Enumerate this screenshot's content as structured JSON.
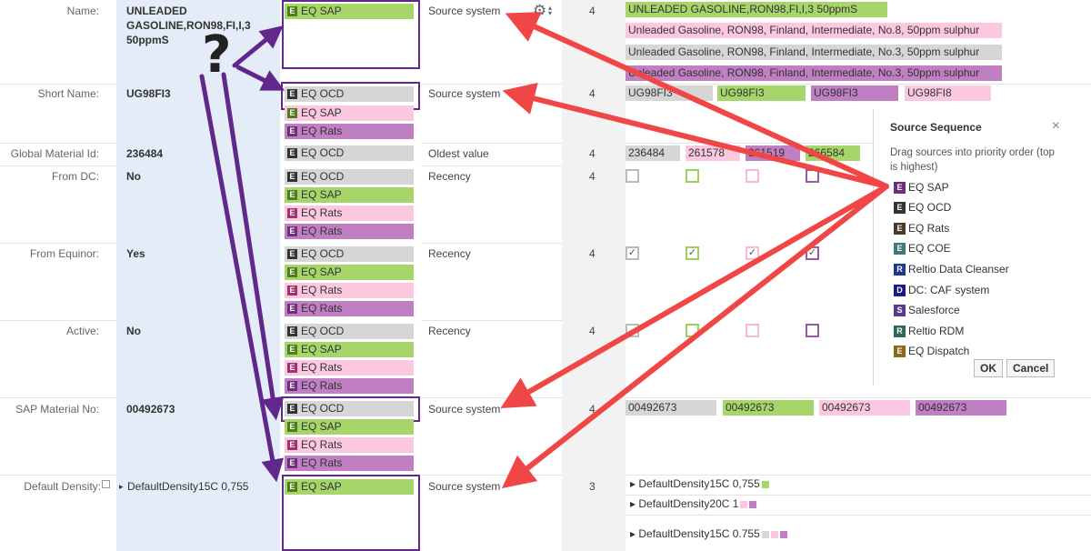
{
  "rows": [
    {
      "label": "Name:",
      "value": "UNLEADED\nGASOLINE,RON98,FI,I,3\n50ppmS",
      "rule": "Source system",
      "count": "4"
    },
    {
      "label": "Short Name:",
      "value": "UG98FI3",
      "rule": "Source system",
      "count": "4"
    },
    {
      "label": "Global Material Id:",
      "value": "236484",
      "rule": "Oldest value",
      "count": "4"
    },
    {
      "label": "From DC:",
      "value": "No",
      "rule": "Recency",
      "count": "4"
    },
    {
      "label": "From Equinor:",
      "value": "Yes",
      "rule": "Recency",
      "count": "4"
    },
    {
      "label": "Active:",
      "value": "No",
      "rule": "Recency",
      "count": "4"
    },
    {
      "label": "SAP Material No:",
      "value": "00492673",
      "rule": "Source system",
      "count": "4"
    },
    {
      "label": "Default Density:",
      "value": "DefaultDensity15C 0,755",
      "rule": "Source system",
      "count": "3"
    }
  ],
  "sources": {
    "eq_sap": "EQ SAP",
    "eq_ocd": "EQ OCD",
    "eq_rats": "EQ Rats",
    "e_letter": "E"
  },
  "values": {
    "name_1": "UNLEADED GASOLINE,RON98,FI,I,3 50ppmS",
    "name_2": "Unleaded Gasoline, RON98, Finland, Intermediate, No.8, 50ppm sulphur",
    "name_3": "Unleaded Gasoline, RON98, Finland, Intermediate, No.3, 50ppm sulphur",
    "name_4": "Unleaded Gasoline, RON98, Finland, Intermediate, No.3, 50ppm sulphur",
    "short_1": "UG98FI3",
    "short_2": "UG98FI3",
    "short_3": "UG98FI3",
    "short_4": "UG98FI8",
    "gmid_1": "236484",
    "gmid_2": "261578",
    "gmid_3": "261519",
    "gmid_4": "266584",
    "sap_1": "00492673",
    "sap_2": "00492673",
    "sap_3": "00492673",
    "sap_4": "00492673",
    "density_1": "DefaultDensity15C 0,755",
    "density_2": "DefaultDensity20C 1",
    "density_3": "DefaultDensity15C 0.755"
  },
  "checkmark": "✓",
  "question": "?",
  "popup": {
    "title": "Source Sequence",
    "close": "×",
    "hint": "Drag sources into priority order (top is highest)",
    "items": [
      {
        "letter": "E",
        "label": "EQ SAP",
        "color": "#6e2f7a"
      },
      {
        "letter": "E",
        "label": "EQ OCD",
        "color": "#333333"
      },
      {
        "letter": "E",
        "label": "EQ Rats",
        "color": "#4a3a2a"
      },
      {
        "letter": "E",
        "label": "EQ COE",
        "color": "#3d7a7a"
      },
      {
        "letter": "R",
        "label": "Reltio Data Cleanser",
        "color": "#1b3a8a"
      },
      {
        "letter": "D",
        "label": "DC: CAF system",
        "color": "#1a1a8a"
      },
      {
        "letter": "S",
        "label": "Salesforce",
        "color": "#5a3a8a"
      },
      {
        "letter": "R",
        "label": "Reltio RDM",
        "color": "#2a6a5a"
      },
      {
        "letter": "E",
        "label": "EQ Dispatch",
        "color": "#8a6a1a"
      }
    ],
    "ok": "OK",
    "cancel": "Cancel"
  },
  "colors": {
    "gray": "#d6d6d6",
    "green": "#a6d66a",
    "pink": "#fbc8df",
    "purple": "#c07fc2",
    "highlight": "#61278a",
    "arrow_red": "#f04646",
    "arrow_purple": "#61278a"
  }
}
